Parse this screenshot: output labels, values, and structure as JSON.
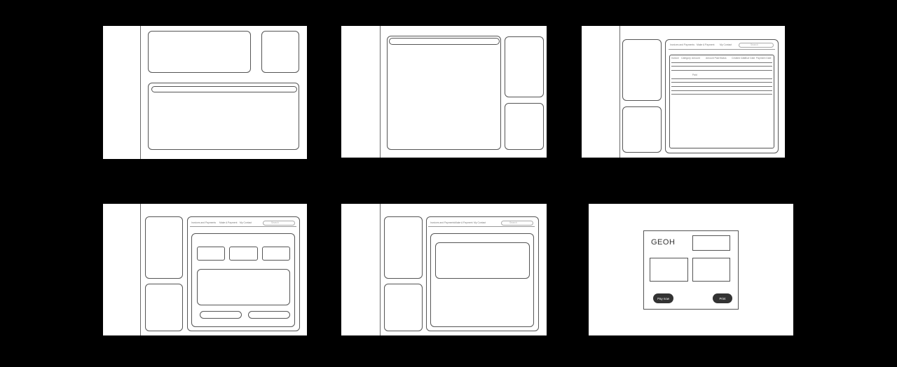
{
  "nav": {
    "item1": "Invoices and Payments",
    "item2": "Make A Payment",
    "item3": "My Contact",
    "search_placeholder": "Search"
  },
  "table": {
    "columns": [
      "Invoice",
      "Category",
      "Amount",
      "Amount Paid",
      "Status",
      "Created Date",
      "Due Date",
      "Payment Date"
    ],
    "cell_text": "Paid"
  },
  "receipt": {
    "logo": "GEOH",
    "pay_now": "Pay now",
    "print": "Print"
  }
}
